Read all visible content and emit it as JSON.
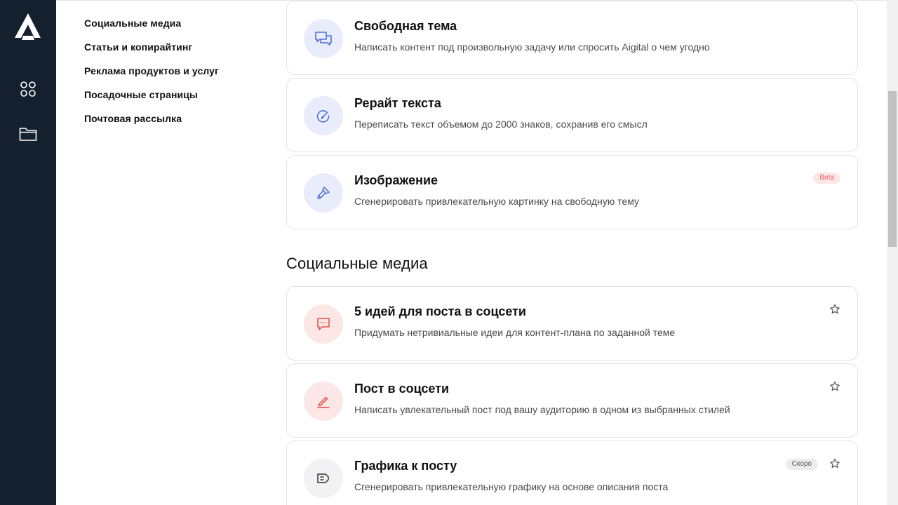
{
  "app": {
    "logo_icon": "aigital-logo-icon"
  },
  "rail": [
    {
      "icon": "apps-grid-icon"
    },
    {
      "icon": "folder-icon"
    }
  ],
  "categories": [
    "Социальные медиа",
    "Статьи и копирайтинг",
    "Реклама продуктов и услуг",
    "Посадочные страницы",
    "Почтовая рассылка"
  ],
  "colors": {
    "sidebar_bg": "#14202e",
    "icon_blue": "#4a6cd4",
    "icon_pink": "#e84a4a",
    "beta_badge_text": "#e35d5d"
  },
  "cards_top": [
    {
      "title": "Свободная тема",
      "desc": "Написать контент под произвольную задачу или спросить Aigital о чем угодно",
      "icon": "chat-bubbles-icon"
    },
    {
      "title": "Рерайт текста",
      "desc": "Переписать текст объемом до 2000 знаков, сохранив его смысл",
      "icon": "rewrite-pen-icon"
    },
    {
      "title": "Изображение",
      "desc": "Сгенерировать привлекательную картинку на свободную тему",
      "icon": "paintbrush-icon",
      "badge": "Beta"
    }
  ],
  "section": {
    "title": "Социальные медиа"
  },
  "cards_social": [
    {
      "title": "5 идей для поста в соцсети",
      "desc": "Придумать нетривиальные идеи для контент-плана по заданной теме",
      "icon": "message-dots-icon"
    },
    {
      "title": "Пост в соцсети",
      "desc": "Написать увлекательный пост под вашу аудиторию в одном из выбранных стилей",
      "icon": "pencil-icon"
    },
    {
      "title": "Графика к посту",
      "desc": "Сгенерировать привлекательную графику на основе описания поста",
      "icon": "graphic-icon",
      "badge": "Скоро"
    }
  ]
}
